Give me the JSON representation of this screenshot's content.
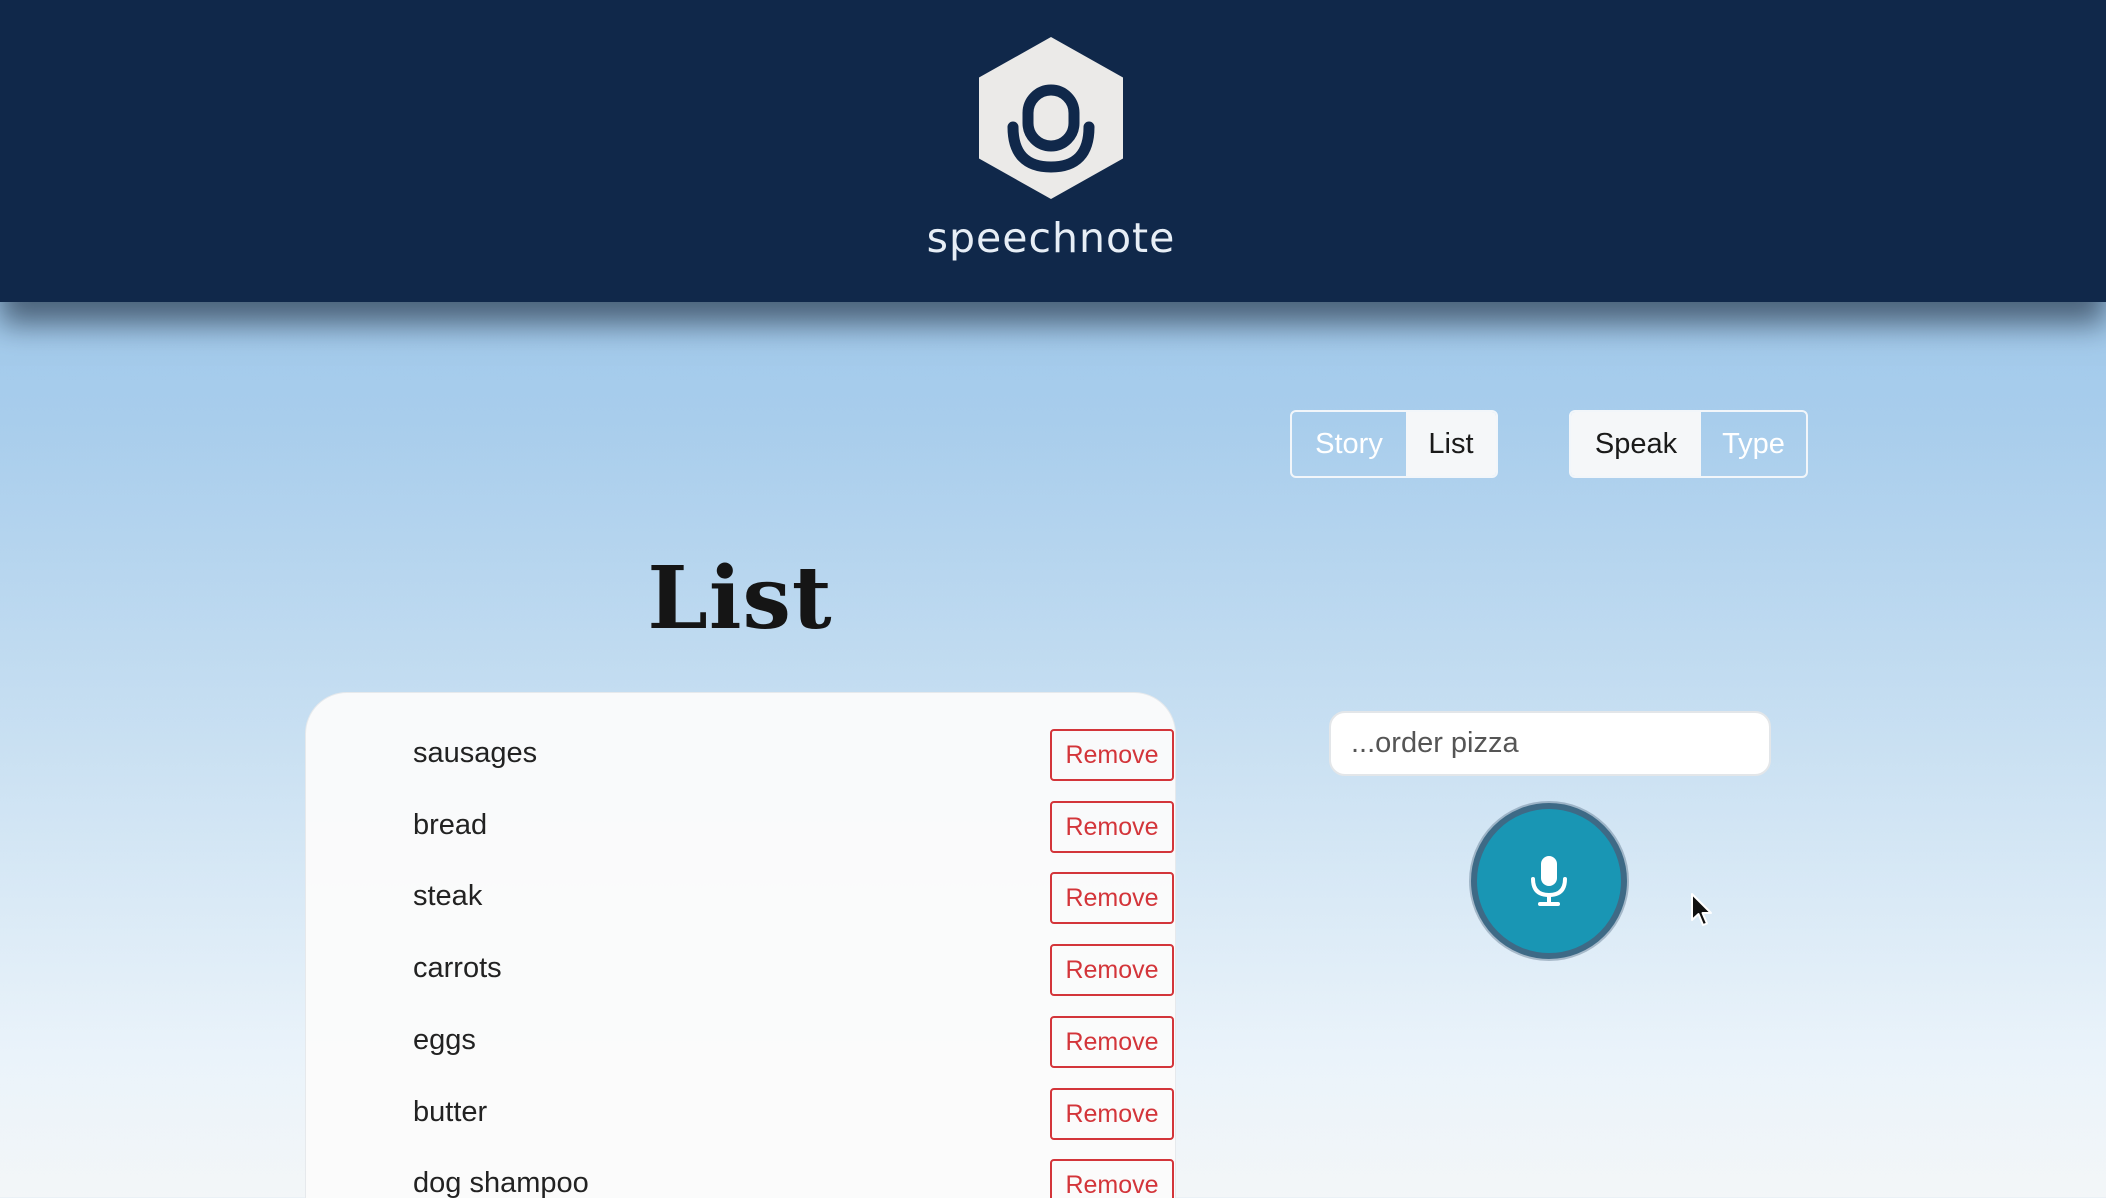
{
  "app": {
    "name": "speechnote",
    "logo_icon": "microphone-hexagon-icon"
  },
  "mode_toggle": {
    "options": [
      "Story",
      "List"
    ],
    "selected": "List"
  },
  "input_toggle": {
    "options": [
      "Speak",
      "Type"
    ],
    "selected": "Speak"
  },
  "list": {
    "title": "List",
    "remove_label": "Remove",
    "items": [
      "sausages",
      "bread",
      "steak",
      "carrots",
      "eggs",
      "butter",
      "dog shampoo"
    ]
  },
  "entry": {
    "placeholder": "...order pizza",
    "value": ""
  },
  "mic_button": {
    "icon": "microphone-icon"
  },
  "colors": {
    "header_bg": "#10284a",
    "accent": "#1996b4",
    "remove": "#d3353a"
  }
}
